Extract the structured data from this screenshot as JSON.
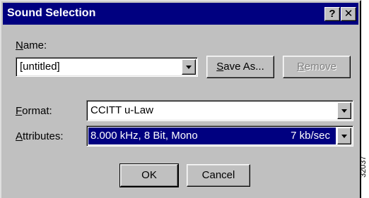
{
  "window": {
    "title": "Sound Selection",
    "help_label": "?",
    "close_label": "✕"
  },
  "name_section": {
    "label_prefix": "",
    "label_u": "N",
    "label_rest": "ame:",
    "value": "[untitled]",
    "save_as_u": "S",
    "save_as_rest": "ave As...",
    "remove_u": "R",
    "remove_rest": "emove"
  },
  "format": {
    "label_u": "F",
    "label_rest": "ormat:",
    "value": "CCITT u-Law"
  },
  "attributes": {
    "label_u": "A",
    "label_rest": "ttributes:",
    "value_left": "8.000 kHz, 8 Bit, Mono",
    "value_right": "7 kb/sec"
  },
  "buttons": {
    "ok": "OK",
    "cancel": "Cancel"
  },
  "figure_id": "32037"
}
